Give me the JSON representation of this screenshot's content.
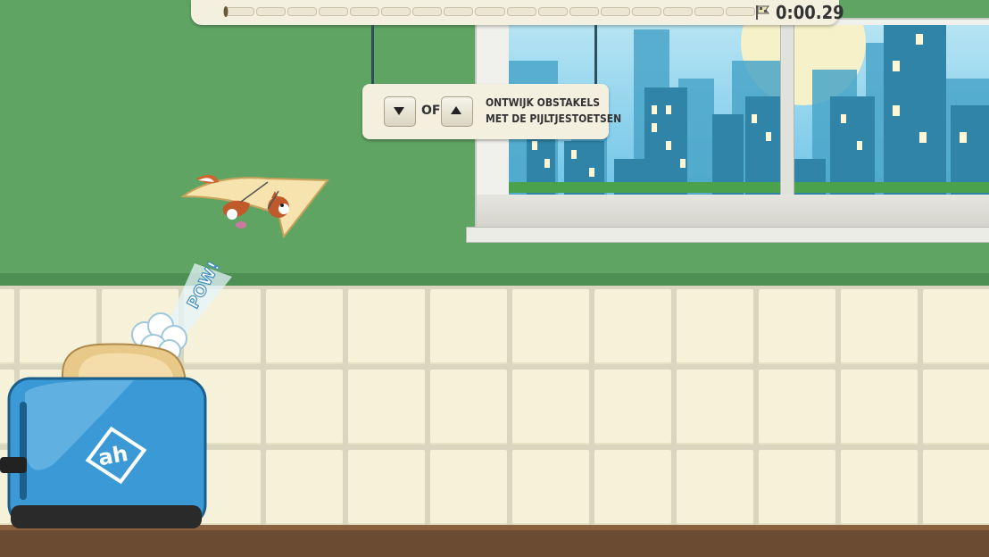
{
  "hud": {
    "timer": "0:00.29",
    "progress": 0.01,
    "finish_flag_icon": "finish-flag-icon"
  },
  "instruction_sign": {
    "down_key_icon": "arrow-down-icon",
    "up_key_icon": "arrow-up-icon",
    "or_label": "OF",
    "line1": "ONTWIJK OBSTAKELS",
    "line2": "MET DE PIJLTJESTOETSEN"
  },
  "effects": {
    "pow_text": "POW!"
  },
  "toaster": {
    "brand_logo_text": "ah",
    "brand_color": "#3b9ad6"
  },
  "colors": {
    "wall": "#60a464",
    "tile": "#f6f2d9",
    "sky": "#6fc4e8",
    "building": "#2f84a8",
    "floor": "#6b4b31"
  }
}
